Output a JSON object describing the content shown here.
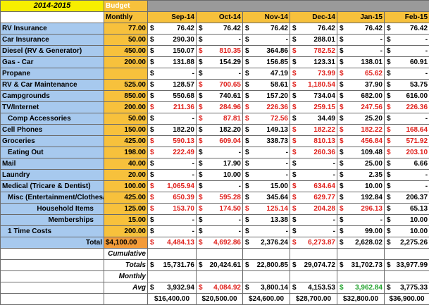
{
  "header": {
    "title": "2014-2015",
    "budget_label": "Budget",
    "monthly_label": "Monthly",
    "months": [
      "Sep-14",
      "Oct-14",
      "Nov-14",
      "Dec-14",
      "Jan-15",
      "Feb-15"
    ]
  },
  "currency_symbol": "$",
  "rows": [
    {
      "label": "RV Insurance",
      "indent": false,
      "align": "left",
      "budget": "77.00",
      "cells": [
        {
          "v": "76.42",
          "c": "black"
        },
        {
          "v": "76.42",
          "c": "black"
        },
        {
          "v": "76.42",
          "c": "black"
        },
        {
          "v": "76.42",
          "c": "black"
        },
        {
          "v": "76.42",
          "c": "black"
        },
        {
          "v": "76.42",
          "c": "black"
        }
      ]
    },
    {
      "label": "Car Insurance",
      "indent": false,
      "align": "left",
      "budget": "50.00",
      "cells": [
        {
          "v": "290.30",
          "c": "black"
        },
        {
          "v": "-",
          "c": "black"
        },
        {
          "v": "-",
          "c": "black"
        },
        {
          "v": "288.01",
          "c": "black"
        },
        {
          "v": "-",
          "c": "black"
        },
        {
          "v": "-",
          "c": "black"
        }
      ]
    },
    {
      "label": "Diesel (RV & Generator)",
      "indent": false,
      "align": "left",
      "budget": "450.00",
      "cells": [
        {
          "v": "150.07",
          "c": "black"
        },
        {
          "v": "810.35",
          "c": "red"
        },
        {
          "v": "364.86",
          "c": "black"
        },
        {
          "v": "782.52",
          "c": "red"
        },
        {
          "v": "-",
          "c": "black"
        },
        {
          "v": "-",
          "c": "black"
        }
      ]
    },
    {
      "label": "Gas - Car",
      "indent": false,
      "align": "left",
      "budget": "200.00",
      "cells": [
        {
          "v": "131.88",
          "c": "black"
        },
        {
          "v": "154.29",
          "c": "black"
        },
        {
          "v": "156.85",
          "c": "black"
        },
        {
          "v": "123.31",
          "c": "black"
        },
        {
          "v": "138.01",
          "c": "black"
        },
        {
          "v": "60.91",
          "c": "black"
        }
      ]
    },
    {
      "label": "Propane",
      "indent": false,
      "align": "left",
      "budget": "",
      "cells": [
        {
          "v": "-",
          "c": "black"
        },
        {
          "v": "-",
          "c": "black"
        },
        {
          "v": "47.19",
          "c": "black"
        },
        {
          "v": "73.99",
          "c": "red"
        },
        {
          "v": "65.62",
          "c": "red"
        },
        {
          "v": "-",
          "c": "black"
        }
      ]
    },
    {
      "label": "RV & Car Maintenance",
      "indent": false,
      "align": "left",
      "budget": "525.00",
      "cells": [
        {
          "v": "128.57",
          "c": "black"
        },
        {
          "v": "700.65",
          "c": "red"
        },
        {
          "v": "58.61",
          "c": "black"
        },
        {
          "v": "1,180.54",
          "c": "red"
        },
        {
          "v": "37.90",
          "c": "black"
        },
        {
          "v": "53.75",
          "c": "black"
        }
      ]
    },
    {
      "label": "Campgrounds",
      "indent": false,
      "align": "left",
      "budget": "850.00",
      "cells": [
        {
          "v": "550.68",
          "c": "black"
        },
        {
          "v": "740.61",
          "c": "black"
        },
        {
          "v": "157.20",
          "c": "black"
        },
        {
          "v": "734.04",
          "c": "black"
        },
        {
          "v": "682.00",
          "c": "black"
        },
        {
          "v": "616.00",
          "c": "black"
        }
      ]
    },
    {
      "label": "TV/Internet",
      "indent": false,
      "align": "left",
      "budget": "200.00",
      "cells": [
        {
          "v": "211.36",
          "c": "red"
        },
        {
          "v": "284.96",
          "c": "red"
        },
        {
          "v": "226.36",
          "c": "red"
        },
        {
          "v": "259.15",
          "c": "red"
        },
        {
          "v": "247.56",
          "c": "red"
        },
        {
          "v": "226.36",
          "c": "red"
        }
      ]
    },
    {
      "label": "Comp Accessories",
      "indent": true,
      "align": "left",
      "budget": "50.00",
      "cells": [
        {
          "v": "-",
          "c": "black"
        },
        {
          "v": "87.81",
          "c": "red"
        },
        {
          "v": "72.56",
          "c": "red"
        },
        {
          "v": "34.49",
          "c": "black"
        },
        {
          "v": "25.20",
          "c": "black"
        },
        {
          "v": "-",
          "c": "black"
        }
      ]
    },
    {
      "label": "Cell Phones",
      "indent": false,
      "align": "left",
      "budget": "150.00",
      "cells": [
        {
          "v": "182.20",
          "c": "black"
        },
        {
          "v": "182.20",
          "c": "black"
        },
        {
          "v": "149.13",
          "c": "black"
        },
        {
          "v": "182.22",
          "c": "red"
        },
        {
          "v": "182.22",
          "c": "red"
        },
        {
          "v": "168.64",
          "c": "red"
        }
      ]
    },
    {
      "label": "Groceries",
      "indent": false,
      "align": "left",
      "budget": "425.00",
      "cells": [
        {
          "v": "590.13",
          "c": "red"
        },
        {
          "v": "609.04",
          "c": "red"
        },
        {
          "v": "338.73",
          "c": "black"
        },
        {
          "v": "810.13",
          "c": "red"
        },
        {
          "v": "456.84",
          "c": "red"
        },
        {
          "v": "571.92",
          "c": "red"
        }
      ]
    },
    {
      "label": "Eating Out",
      "indent": true,
      "align": "left",
      "budget": "198.00",
      "cells": [
        {
          "v": "222.49",
          "c": "red"
        },
        {
          "v": "-",
          "c": "black"
        },
        {
          "v": "-",
          "c": "black"
        },
        {
          "v": "260.36",
          "c": "red"
        },
        {
          "v": "109.48",
          "c": "black"
        },
        {
          "v": "203.10",
          "c": "red"
        }
      ]
    },
    {
      "label": "Mail",
      "indent": false,
      "align": "left",
      "budget": "40.00",
      "cells": [
        {
          "v": "-",
          "c": "black"
        },
        {
          "v": "17.90",
          "c": "black"
        },
        {
          "v": "-",
          "c": "black"
        },
        {
          "v": "-",
          "c": "black"
        },
        {
          "v": "25.00",
          "c": "black"
        },
        {
          "v": "6.66",
          "c": "black"
        }
      ]
    },
    {
      "label": "Laundry",
      "indent": false,
      "align": "left",
      "budget": "20.00",
      "cells": [
        {
          "v": "-",
          "c": "black"
        },
        {
          "v": "10.00",
          "c": "black"
        },
        {
          "v": "-",
          "c": "black"
        },
        {
          "v": "-",
          "c": "black"
        },
        {
          "v": "2.35",
          "c": "black"
        },
        {
          "v": "-",
          "c": "black"
        }
      ]
    },
    {
      "label": "Medical (Tricare & Dentist)",
      "indent": false,
      "align": "left",
      "budget": "100.00",
      "cells": [
        {
          "v": "1,065.94",
          "c": "red"
        },
        {
          "v": "-",
          "c": "black"
        },
        {
          "v": "15.00",
          "c": "black"
        },
        {
          "v": "634.64",
          "c": "red"
        },
        {
          "v": "10.00",
          "c": "black"
        },
        {
          "v": "-",
          "c": "black"
        }
      ]
    },
    {
      "label": "Misc (Entertainment/Clothes/G",
      "indent": true,
      "align": "left",
      "budget": "425.00",
      "cells": [
        {
          "v": "650.39",
          "c": "red"
        },
        {
          "v": "595.28",
          "c": "red"
        },
        {
          "v": "345.64",
          "c": "black"
        },
        {
          "v": "629.77",
          "c": "red"
        },
        {
          "v": "192.84",
          "c": "black"
        },
        {
          "v": "206.37",
          "c": "black"
        }
      ]
    },
    {
      "label": "Household Items",
      "indent": false,
      "align": "right",
      "budget": "125.00",
      "cells": [
        {
          "v": "153.70",
          "c": "red"
        },
        {
          "v": "174.50",
          "c": "red"
        },
        {
          "v": "125.14",
          "c": "red"
        },
        {
          "v": "204.28",
          "c": "red"
        },
        {
          "v": "296.13",
          "c": "red"
        },
        {
          "v": "65.13",
          "c": "black"
        }
      ]
    },
    {
      "label": "Memberships",
      "indent": false,
      "align": "right",
      "budget": "15.00",
      "cells": [
        {
          "v": "-",
          "c": "black"
        },
        {
          "v": "-",
          "c": "black"
        },
        {
          "v": "13.38",
          "c": "black"
        },
        {
          "v": "-",
          "c": "black"
        },
        {
          "v": "-",
          "c": "black"
        },
        {
          "v": "10.00",
          "c": "black"
        }
      ]
    },
    {
      "label": "1 Time Costs",
      "indent": true,
      "align": "left",
      "budget": "200.00",
      "cells": [
        {
          "v": "-",
          "c": "black"
        },
        {
          "v": "-",
          "c": "black"
        },
        {
          "v": "-",
          "c": "black"
        },
        {
          "v": "-",
          "c": "black"
        },
        {
          "v": "99.00",
          "c": "black"
        },
        {
          "v": "10.00",
          "c": "black"
        }
      ]
    }
  ],
  "total": {
    "label": "Total",
    "budget": "$4,100.00",
    "cells": [
      {
        "v": "4,484.13",
        "c": "red"
      },
      {
        "v": "4,692.86",
        "c": "red"
      },
      {
        "v": "2,376.24",
        "c": "black"
      },
      {
        "v": "6,273.87",
        "c": "red"
      },
      {
        "v": "2,628.02",
        "c": "black"
      },
      {
        "v": "2,275.26",
        "c": "black"
      }
    ]
  },
  "cumulative": {
    "label_top": "Cumulative",
    "label_bottom": "Totals",
    "cells": [
      {
        "v": "15,731.76",
        "c": "black"
      },
      {
        "v": "20,424.61",
        "c": "black"
      },
      {
        "v": "22,800.85",
        "c": "black"
      },
      {
        "v": "29,074.72",
        "c": "black"
      },
      {
        "v": "31,702.73",
        "c": "black"
      },
      {
        "v": "33,977.99",
        "c": "black"
      }
    ]
  },
  "monthly_avg": {
    "label_top": "Monthly",
    "label_bottom": "Avg",
    "cells": [
      {
        "v": "3,932.94",
        "c": "black"
      },
      {
        "v": "4,084.92",
        "c": "red"
      },
      {
        "v": "3,800.14",
        "c": "black"
      },
      {
        "v": "4,153.53",
        "c": "black"
      },
      {
        "v": "3,962.84",
        "c": "green"
      },
      {
        "v": "3,775.33",
        "c": "black"
      }
    ]
  },
  "budget_totals": [
    "$16,400.00",
    "$20,500.00",
    "$24,600.00",
    "$28,700.00",
    "$32,800.00",
    "$36,900.00"
  ],
  "colors": {
    "red": "#e0201b",
    "green": "#1ea12a",
    "label_bg": "#a7c9ee",
    "budget_bg": "#f7c13c",
    "title_bg": "#f6ee00"
  }
}
